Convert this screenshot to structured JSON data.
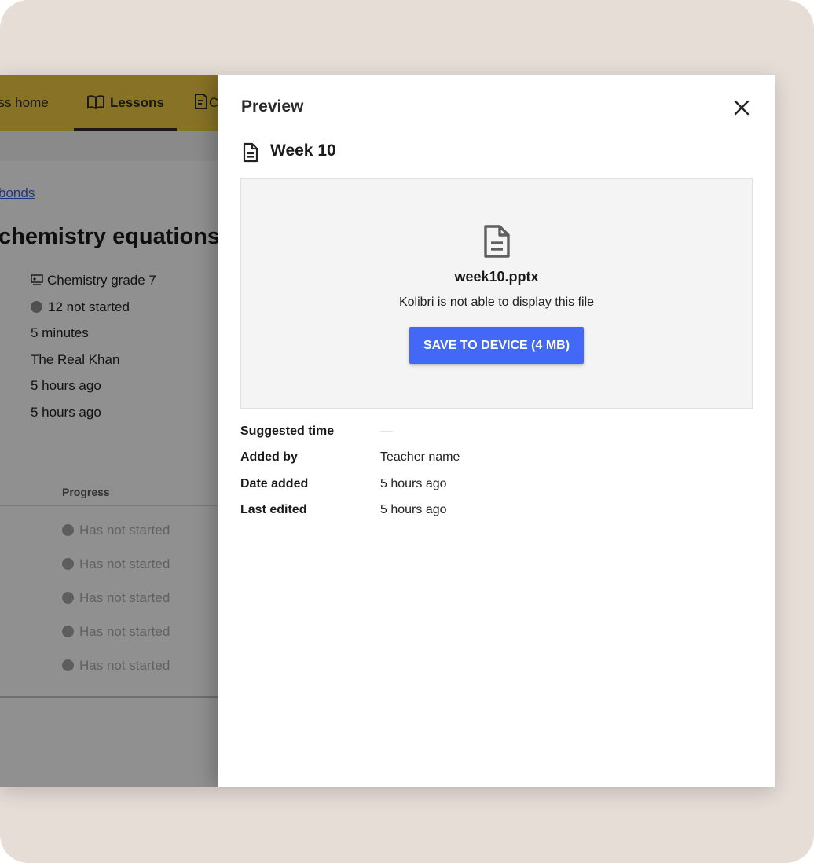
{
  "background_page": {
    "nav": {
      "class_home": "ass home",
      "lessons": "Lessons",
      "quizzes": "C"
    },
    "breadcrumb": "bonds",
    "lesson_title": "chemistry equations",
    "meta": {
      "class_name": "Chemistry grade 7",
      "not_started": "12 not started",
      "duration": "5 minutes",
      "author": "The Real Khan",
      "created": "5 hours ago",
      "updated": "5 hours ago"
    },
    "table": {
      "progress_header": "Progress",
      "rows": [
        {
          "status": "Has not started"
        },
        {
          "status": "Has not started"
        },
        {
          "status": "Has not started"
        },
        {
          "status": "Has not started"
        },
        {
          "status": "Has not started"
        }
      ]
    },
    "accent_color": "#e8c441"
  },
  "panel": {
    "title": "Preview",
    "resource_title": "Week 10",
    "preview": {
      "file_name": "week10.pptx",
      "message": "Kolibri is not able to display this file",
      "save_button": "SAVE TO DEVICE (4 MB)"
    },
    "details": {
      "suggested_time_label": "Suggested time",
      "suggested_time_value": "—",
      "added_by_label": "Added by",
      "added_by_value": "Teacher name",
      "date_added_label": "Date added",
      "date_added_value": "5 hours ago",
      "last_edited_label": "Last edited",
      "last_edited_value": "5 hours ago"
    },
    "button_color": "#4368f5",
    "icons": {
      "close": "close-icon",
      "resource": "document-icon",
      "file": "file-icon"
    }
  }
}
